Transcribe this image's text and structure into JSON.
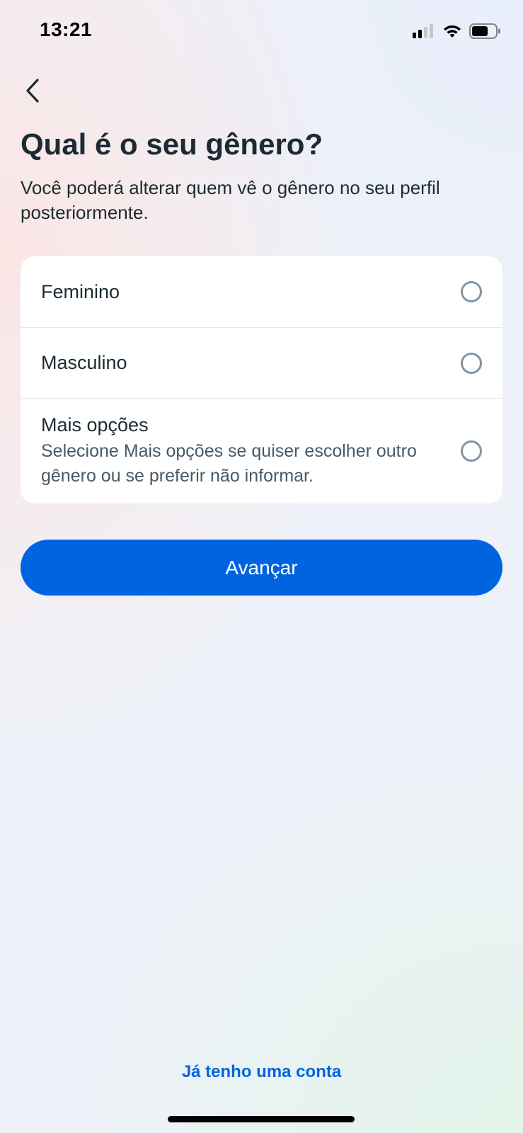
{
  "status_bar": {
    "time": "13:21",
    "icons": [
      "cellular-signal-icon",
      "wifi-icon",
      "battery-icon"
    ]
  },
  "navigation": {
    "back_icon": "chevron-left-icon"
  },
  "header": {
    "title": "Qual é o seu gênero?",
    "subtitle": "Você poderá alterar quem vê o gênero no seu perfil posteriormente."
  },
  "options": [
    {
      "label": "Feminino",
      "selected": false
    },
    {
      "label": "Masculino",
      "selected": false
    },
    {
      "label": "Mais opções",
      "description": "Selecione Mais opções se quiser escolher outro gênero ou se preferir não informar.",
      "selected": false
    }
  ],
  "actions": {
    "next_label": "Avançar",
    "login_link": "Já tenho uma conta"
  },
  "colors": {
    "primary": "#0064e0",
    "text": "#1c2b33",
    "secondary_text": "#465a69",
    "radio_border": "#8595a4"
  }
}
